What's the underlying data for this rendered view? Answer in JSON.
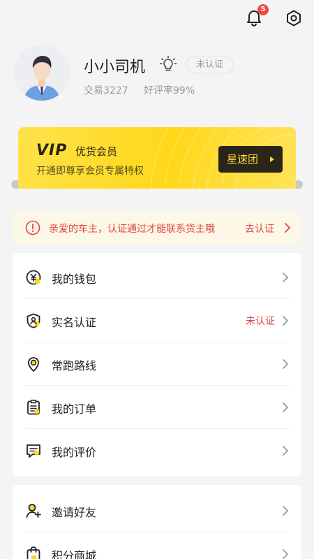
{
  "header": {
    "bell_icon": "bell-icon",
    "notification_count": "5",
    "settings_icon": "gear-icon"
  },
  "profile": {
    "name": "小小司机",
    "bulb_icon": "lightbulb-icon",
    "verify_status": "未认证",
    "trades": "交易3227",
    "rating": "好评率99%"
  },
  "vip": {
    "logo": "VIP",
    "title": "优货会员",
    "subtitle": "开通即尊享会员专属特权",
    "button": "星速团",
    "colors": {
      "card": "#ffd81a",
      "button": "#2a2519"
    }
  },
  "notice": {
    "text": "亲爱的车主，认证通过才能联系货主哦",
    "link": "去认证",
    "color": "#e04545"
  },
  "menu_primary": [
    {
      "label": "我的钱包",
      "icon": "wallet-yen-icon",
      "value": ""
    },
    {
      "label": "实名认证",
      "icon": "shield-user-icon",
      "value": "未认证"
    },
    {
      "label": "常跑路线",
      "icon": "location-pin-icon",
      "value": ""
    },
    {
      "label": "我的订单",
      "icon": "clipboard-icon",
      "value": ""
    },
    {
      "label": "我的评价",
      "icon": "comment-icon",
      "value": ""
    }
  ],
  "menu_secondary": [
    {
      "label": "邀请好友",
      "icon": "add-user-icon"
    },
    {
      "label": "积分商城",
      "icon": "shopping-bag-icon"
    }
  ]
}
